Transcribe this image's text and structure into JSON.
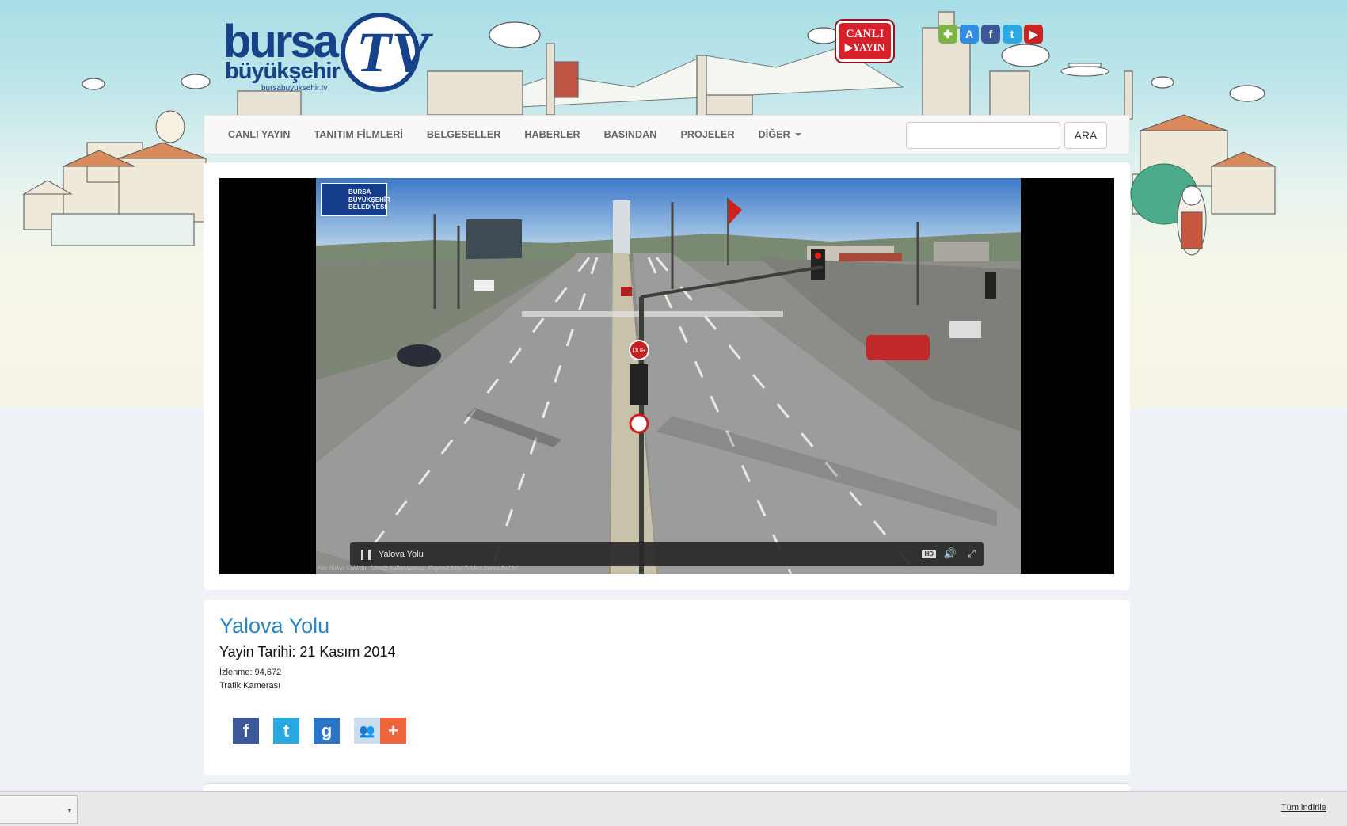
{
  "brand": {
    "line1": "bursa",
    "line2": "büyükşehir",
    "url": "bursabuyuksehir.tv",
    "mark": "TV"
  },
  "live_badge": {
    "line1": "CANLI",
    "line2": "YAYIN"
  },
  "social_top": [
    {
      "name": "android-icon",
      "color": "#7cb342",
      "glyph": "✚"
    },
    {
      "name": "appstore-icon",
      "color": "#2f8de4",
      "glyph": "A"
    },
    {
      "name": "facebook-icon",
      "color": "#3b5998",
      "glyph": "f"
    },
    {
      "name": "twitter-icon",
      "color": "#2aa9e0",
      "glyph": "t"
    },
    {
      "name": "youtube-icon",
      "color": "#cc2222",
      "glyph": "▶"
    }
  ],
  "nav": {
    "items": [
      {
        "label": "CANLI YAYIN"
      },
      {
        "label": "TANITIM FİLMLERİ"
      },
      {
        "label": "BELGESELLER"
      },
      {
        "label": "HABERLER"
      },
      {
        "label": "BASINDAN"
      },
      {
        "label": "PROJELER"
      },
      {
        "label": "DİĞER"
      }
    ],
    "search_placeholder": "",
    "search_button": "ARA"
  },
  "video": {
    "cam_logo": "BURSA BÜYÜKŞEHİR BELEDİYESİ",
    "control_title": "Yalova Yolu",
    "hd_label": "HD",
    "copyright": "Her hakkı saklıdır. İzinsiz kullanılamaz. Kaynak:http://video.bursa.bel.tr/",
    "sign_stop": "DUR"
  },
  "info": {
    "title": "Yalova Yolu",
    "date": "Yayin Tarihi: 21 Kasım 2014",
    "views": "İzlenme: 94,672",
    "category": "Trafik Kamerası"
  },
  "share": [
    {
      "name": "share-facebook-icon",
      "color": "#3b5998",
      "glyph": "f"
    },
    {
      "name": "share-twitter-icon",
      "color": "#2aa9e0",
      "glyph": "t"
    },
    {
      "name": "share-google-icon",
      "color": "#2b74c6",
      "glyph": "g"
    },
    {
      "name": "share-myspace-icon",
      "color": "#c9dff0",
      "glyph": "👥"
    },
    {
      "name": "share-more-icon",
      "color": "#f0643c",
      "glyph": "+"
    }
  ],
  "downloads_bar": {
    "all_label": "Tüm indirile"
  }
}
